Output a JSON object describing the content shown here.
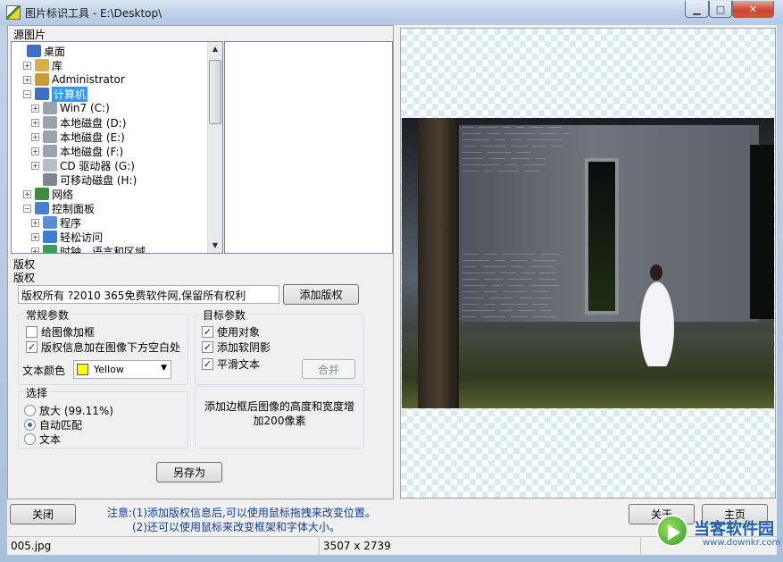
{
  "window": {
    "title": "图片标识工具 - E:\\Desktop\\",
    "min_glyph": "▁",
    "max_glyph": "□",
    "close_glyph": "✕"
  },
  "source": {
    "label": "源图片",
    "tree": [
      {
        "label": "桌面",
        "icon": "desktop-icon",
        "color": "#3a6fc4"
      },
      {
        "label": "库",
        "icon": "library-icon",
        "color": "#d8b04a"
      },
      {
        "label": "Administrator",
        "icon": "user-folder-icon",
        "color": "#c99a3a"
      },
      {
        "label": "计算机",
        "icon": "computer-icon",
        "color": "#3a6fc4",
        "selected": true
      },
      {
        "label": "Win7 (C:)",
        "icon": "drive-icon",
        "color": "#9aa3ad"
      },
      {
        "label": "本地磁盘 (D:)",
        "icon": "drive-icon",
        "color": "#9aa3ad"
      },
      {
        "label": "本地磁盘 (E:)",
        "icon": "drive-icon",
        "color": "#9aa3ad"
      },
      {
        "label": "本地磁盘 (F:)",
        "icon": "drive-icon",
        "color": "#9aa3ad"
      },
      {
        "label": "CD 驱动器 (G:)",
        "icon": "cd-drive-icon",
        "color": "#b8bec5"
      },
      {
        "label": "可移动磁盘 (H:)",
        "icon": "removable-drive-icon",
        "color": "#7d858d"
      },
      {
        "label": "网络",
        "icon": "network-icon",
        "color": "#3b8f3b"
      },
      {
        "label": "控制面板",
        "icon": "control-panel-icon",
        "color": "#4a7fcf"
      },
      {
        "label": "程序",
        "icon": "programs-icon",
        "color": "#5a8fd6"
      },
      {
        "label": "轻松访问",
        "icon": "ease-access-icon",
        "color": "#3a7fd0"
      },
      {
        "label": "时钟、语言和区域",
        "icon": "clock-globe-icon",
        "color": "#3c9a5a"
      }
    ]
  },
  "copyright": {
    "section_label": "版权",
    "field_label": "版权",
    "text": "版权所有 ?2010 365免费软件网,保留所有权利",
    "add_button": "添加版权"
  },
  "general": {
    "title": "常规参数",
    "frame_label": "给图像加框",
    "frame_checked": false,
    "below_label": "版权信息加在图像下方空白处",
    "below_checked": true,
    "text_color_label": "文本颜色",
    "text_color_value": "Yellow",
    "text_color_hex": "#ffff00"
  },
  "target": {
    "title": "目标参数",
    "use_object_label": "使用对象",
    "use_object_checked": true,
    "soft_shadow_label": "添加软阴影",
    "soft_shadow_checked": true,
    "smooth_text_label": "平滑文本",
    "smooth_text_checked": true,
    "merge_button": "合并"
  },
  "select": {
    "title": "选择",
    "zoom_label": "放大 (99.11%)",
    "auto_label": "自动匹配",
    "text_label": "文本",
    "selected": "auto"
  },
  "info_text": "添加边框后图像的高度和宽度增加200像素",
  "save_as_button": "另存为",
  "bottom": {
    "close_button": "关闭",
    "notice_line1": "注意:(1)添加版权信息后,可以使用鼠标拖拽来改变位置。",
    "notice_line2": "(2)还可以使用鼠标来改变框架和字体大小。",
    "about_button": "关于",
    "home_button": "主页"
  },
  "status": {
    "filename": "005.jpg",
    "dimensions": "3507 x 2739"
  },
  "watermark": {
    "text": "当客软件园",
    "url": "www.downkr.com"
  },
  "glyphs": {
    "expand": "+",
    "collapse": "−",
    "check": "✓",
    "dropdown": "▼",
    "scroll_up": "▲",
    "scroll_down": "▼"
  }
}
